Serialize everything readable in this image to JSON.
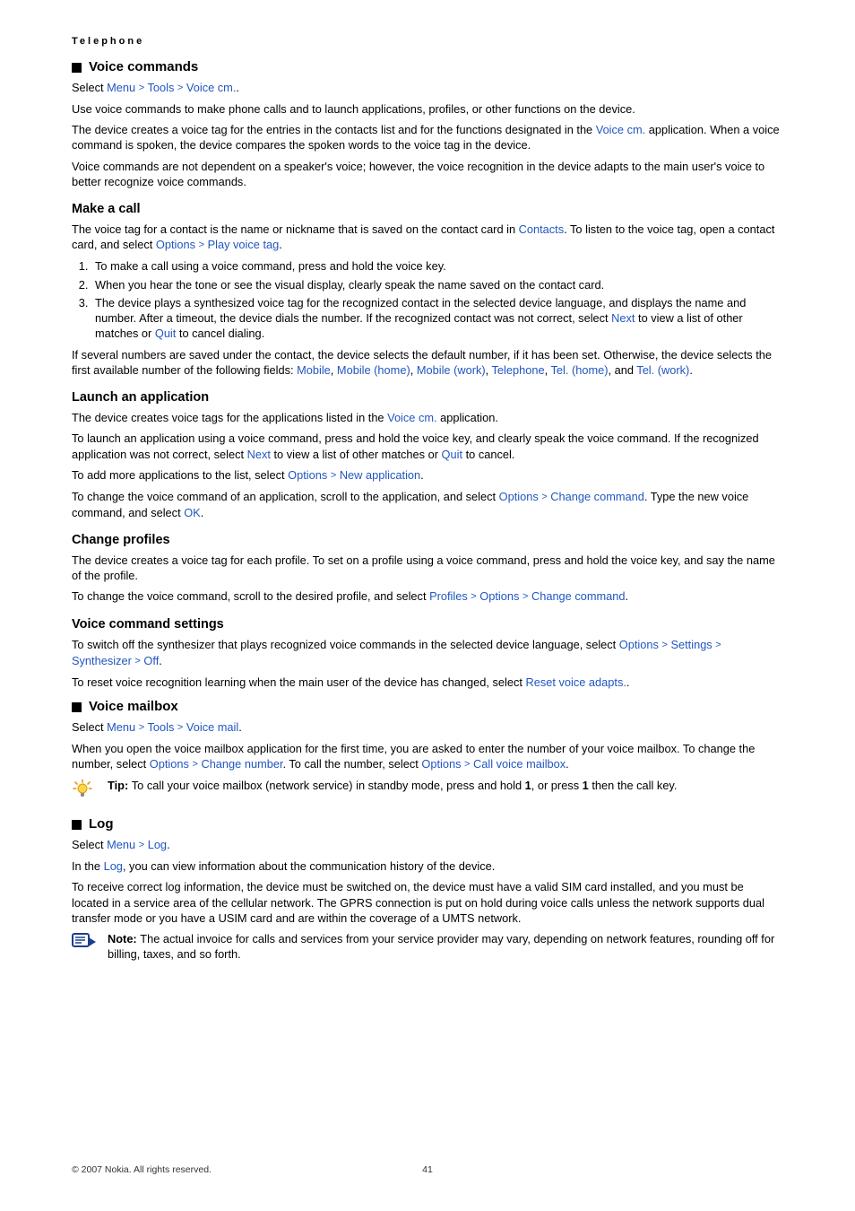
{
  "kicker": "Telephone",
  "sections": {
    "voice_commands": {
      "title": "Voice commands",
      "select_prefix": "Select ",
      "select_path": [
        "Menu",
        "Tools",
        "Voice cm."
      ],
      "p1": "Use voice commands to make phone calls and to launch applications, profiles, or other functions on the device.",
      "p2_a": "The device creates a voice tag for the entries in the contacts list and for the functions designated in the ",
      "p2_link": "Voice cm.",
      "p2_b": " application. When a voice command is spoken, the device compares the spoken words to the voice tag in the device.",
      "p3": "Voice commands are not dependent on a speaker's voice; however, the voice recognition in the device adapts to the main user's voice to better recognize voice commands.",
      "make_call": {
        "title": "Make a call",
        "p1_a": "The voice tag for a contact is the name or nickname that is saved on the contact card in ",
        "p1_link": "Contacts",
        "p1_b": ". To listen to the voice tag, open a contact card, and select ",
        "p1_opt": "Options",
        "p1_play": "Play voice tag",
        "li1": "To make a call using a voice command, press and hold the voice key.",
        "li2": "When you hear the tone or see the visual display, clearly speak the name saved on the contact card.",
        "li3_a": "The device plays a synthesized voice tag for the recognized contact in the selected device language, and displays the name and number. After a timeout, the device dials the number. If the recognized contact was not correct, select ",
        "li3_next": "Next",
        "li3_b": " to view a list of other matches or ",
        "li3_quit": "Quit",
        "li3_c": " to cancel dialing.",
        "p2_a": "If several numbers are saved under the contact, the device selects the default number, if it has been set. Otherwise, the device selects the first available number of the following fields: ",
        "fields": [
          "Mobile",
          "Mobile (home)",
          "Mobile (work)",
          "Telephone",
          "Tel. (home)",
          "Tel. (work)"
        ]
      },
      "launch_app": {
        "title": "Launch an application",
        "p1_a": "The device creates voice tags for the applications listed in the ",
        "p1_link": "Voice cm.",
        "p1_b": " application.",
        "p2_a": "To launch an application using a voice command, press and hold the voice key, and clearly speak the voice command. If the recognized application was not correct, select ",
        "p2_next": "Next",
        "p2_b": " to view a list of other matches or ",
        "p2_quit": "Quit",
        "p2_c": " to cancel.",
        "p3_a": "To add more applications to the list, select ",
        "p3_opt": "Options",
        "p3_new": "New application",
        "p4_a": "To change the voice command of an application, scroll to the application, and select ",
        "p4_opt": "Options",
        "p4_chg": "Change command",
        "p4_b": ". Type the new voice command, and select ",
        "p4_ok": "OK"
      },
      "change_profiles": {
        "title": "Change profiles",
        "p1": "The device creates a voice tag for each profile. To set on a profile using a voice command, press and hold the voice key, and say the name of the profile.",
        "p2_a": "To change the voice command, scroll to the desired profile, and select ",
        "p2_path": [
          "Profiles",
          "Options",
          "Change command"
        ]
      },
      "vc_settings": {
        "title": "Voice command settings",
        "p1_a": "To switch off the synthesizer that plays recognized voice commands in the selected device language, select ",
        "p1_path": [
          "Options",
          "Settings",
          "Synthesizer",
          "Off"
        ],
        "p2_a": "To reset voice recognition learning when the main user of the device has changed, select ",
        "p2_link": "Reset voice adapts."
      }
    },
    "voice_mailbox": {
      "title": "Voice mailbox",
      "select_prefix": "Select ",
      "select_path": [
        "Menu",
        "Tools",
        "Voice mail"
      ],
      "p1_a": "When you open the voice mailbox application for the first time, you are asked to enter the number of your voice mailbox. To change the number, select ",
      "p1_path1": [
        "Options",
        "Change number"
      ],
      "p1_b": ". To call the number, select ",
      "p1_path2": [
        "Options",
        "Call voice mailbox"
      ],
      "tip_label": "Tip: ",
      "tip_a": "To call your voice mailbox (network service) in standby mode, press and hold ",
      "tip_key1": "1",
      "tip_b": ", or press ",
      "tip_key2": "1",
      "tip_c": " then the call key."
    },
    "log": {
      "title": "Log",
      "select_prefix": "Select ",
      "select_path": [
        "Menu",
        "Log"
      ],
      "p1_a": "In the ",
      "p1_link": "Log",
      "p1_b": ", you can view information about the communication history of the device.",
      "p2": "To receive correct log information, the device must be switched on, the device must have a valid SIM card installed, and you must be located in a service area of the cellular network. The GPRS connection is put on hold during voice calls unless the network supports dual transfer mode or you have a USIM card and are within the coverage of a UMTS network.",
      "note_label": "Note:  ",
      "note_text": "The actual invoice for calls and services from your service provider may vary, depending on network features, rounding off for billing, taxes, and so forth."
    }
  },
  "footer": {
    "copyright": "© 2007 Nokia. All rights reserved.",
    "page": "41"
  }
}
